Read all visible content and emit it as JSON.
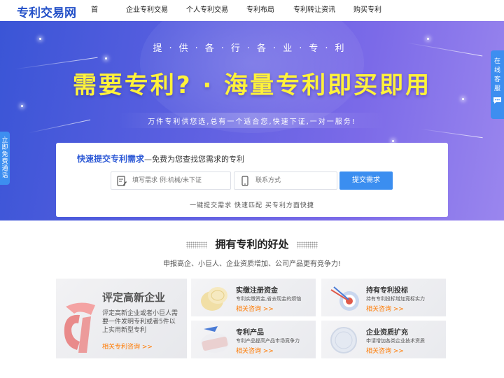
{
  "header": {
    "logo": "专利交易网",
    "nav": [
      "首页",
      "企业专利交易",
      "个人专利交易",
      "专利布局",
      "专利转让资讯",
      "购买专利"
    ]
  },
  "hero": {
    "subtitle": "提·供·各·行·各·业·专·利",
    "title": "需要专利? · 海量专利即买即用",
    "tagline": "万件专利供您选,总有一个适合您,快速下证,一对一服务!"
  },
  "form": {
    "heading_strong": "快速提交专利需求",
    "heading_rest": "—免费为您查找您需求的专利",
    "need_placeholder": "填写需求 例:机械/未下证",
    "contact_placeholder": "联系方式",
    "submit_label": "提交需求",
    "note": "一键提交需求  快速匹配  买专利方面快捷"
  },
  "side": {
    "left_label": "立即免费通话",
    "right_label": "在线客服"
  },
  "benefits": {
    "title": "拥有专利的好处",
    "subtitle": "申报高企、小巨人、企业资质增加、公司产品更有竞争力!",
    "featured": {
      "title": "评定高新企业",
      "desc": "评定高新企业或者小巨人需要一件发明专利或者5件以上实用新型专利",
      "link": "相关专利咨询 >>"
    },
    "cards": [
      {
        "title": "实缴注册资金",
        "desc": "专利实缴资金,省去现金的烦恼",
        "link": "相关咨询 >>"
      },
      {
        "title": "持有专利投标",
        "desc": "持有专利投标增加竞标实力",
        "link": "相关咨询 >>"
      },
      {
        "title": "专利产品",
        "desc": "专利产品提高产品市场竞争力",
        "link": "相关咨询 >>"
      },
      {
        "title": "企业资质扩充",
        "desc": "申请增加各类企业技术资质",
        "link": "相关咨询 >>"
      }
    ]
  },
  "colors": {
    "brand_blue": "#2350c8",
    "button_blue": "#3b8ef0",
    "hero_title_yellow": "#fff23a",
    "link_orange": "#ff7a00"
  }
}
